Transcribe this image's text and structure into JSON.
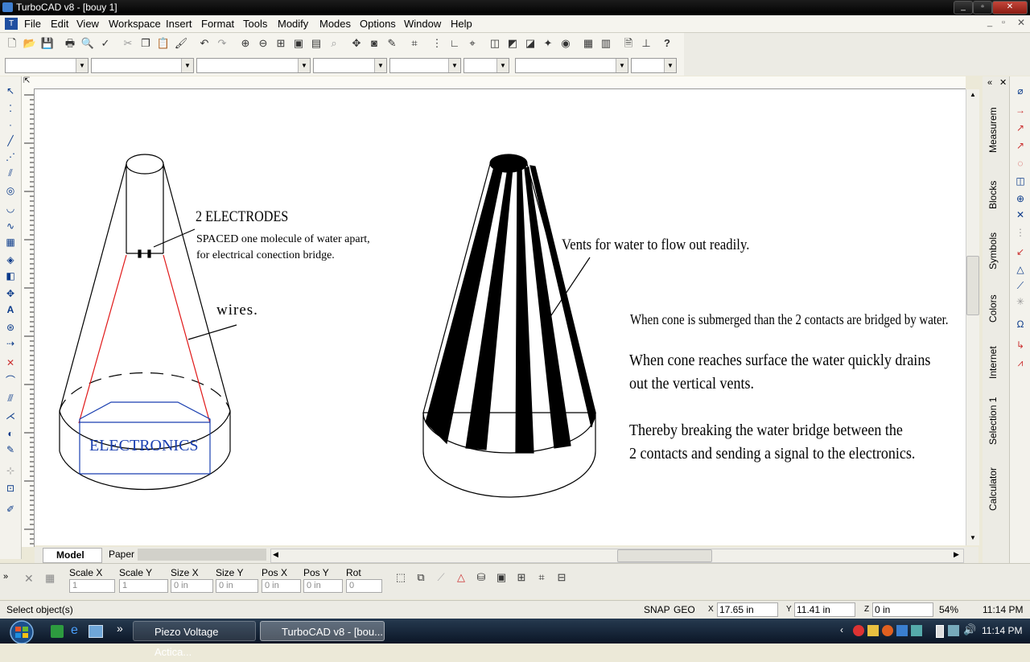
{
  "window": {
    "title": "TurboCAD v8 - [bouy 1]"
  },
  "menu": [
    "File",
    "Edit",
    "View",
    "Workspace",
    "Insert",
    "Format",
    "Tools",
    "Modify",
    "Modes",
    "Options",
    "Window",
    "Help"
  ],
  "sidebar_tabs": [
    "Measurem",
    "Blocks",
    "Symbols",
    "Colors",
    "Internet",
    "Selection 1",
    "Calculator"
  ],
  "drawing": {
    "left": {
      "electrodes_title": "2 ELECTRODES",
      "electrodes_line1": "SPACED one molecule of water apart,",
      "electrodes_line2": "for electrical conection bridge.",
      "wires_label": "wires.",
      "electronics_label": "ELECTRONICS"
    },
    "right": {
      "vents_label": "Vents for water to flow out readily.",
      "note1": "When cone is submerged than the 2 contacts are bridged by water.",
      "note2_line1": "When cone reaches surface the water quickly drains",
      "note2_line2": "out the vertical vents.",
      "note3_line1": "Thereby breaking the water bridge between the",
      "note3_line2": "2 contacts and sending a signal to the electronics."
    },
    "colors": {
      "wire": "#e01818",
      "electronics": "#1a3fb0"
    }
  },
  "tabs": {
    "model": "Model",
    "paper": "Paper"
  },
  "inspector": {
    "fields": [
      {
        "label": "Scale X",
        "value": "1"
      },
      {
        "label": "Scale Y",
        "value": "1"
      },
      {
        "label": "Size X",
        "value": "0 in"
      },
      {
        "label": "Size Y",
        "value": "0 in"
      },
      {
        "label": "Pos X",
        "value": "0 in"
      },
      {
        "label": "Pos Y",
        "value": "0 in"
      },
      {
        "label": "Rot",
        "value": "0"
      }
    ]
  },
  "status": {
    "prompt": "Select object(s)",
    "snap": "SNAP",
    "geo": "GEO",
    "x": "17.65 in",
    "y": "11.41 in",
    "z": "0 in",
    "zoom": "54%",
    "time": "11:14 PM"
  },
  "taskbar": {
    "items": [
      "Piezo Voltage Actica...",
      "TurboCAD v8 - [bou..."
    ],
    "clock": "11:14 PM"
  }
}
